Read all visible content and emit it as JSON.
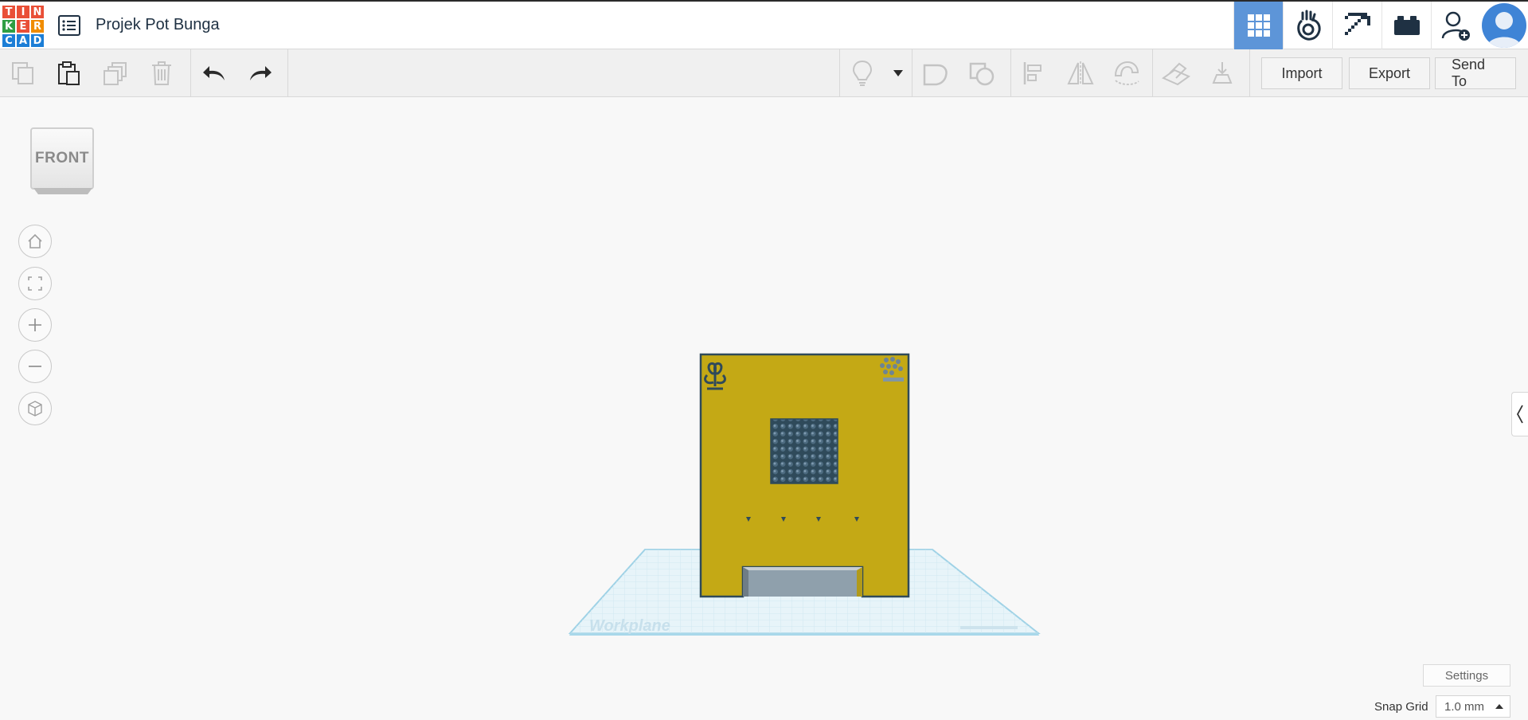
{
  "app": {
    "logo_letters": [
      "T",
      "I",
      "N",
      "K",
      "E",
      "R",
      "C",
      "A",
      "D"
    ],
    "logo_colors": [
      "#e94f37",
      "#e94f37",
      "#e94f37",
      "#2f9e44",
      "#e94f37",
      "#f08c00",
      "#1c7ed6",
      "#1c7ed6",
      "#1c7ed6"
    ],
    "project_title": "Projek Pot Bunga"
  },
  "top_nav": {
    "active_color": "#5d95d8",
    "icons": [
      "grid-3d-icon",
      "circuits-icon",
      "minecraft-pickaxe-icon",
      "lego-bricks-icon",
      "add-user-icon"
    ]
  },
  "toolbar": {
    "import_label": "Import",
    "export_label": "Export",
    "send_to_label": "Send To"
  },
  "viewcube": {
    "face_label": "FRONT"
  },
  "workplane": {
    "label": "Workplane",
    "label_color": "#c7e0ec"
  },
  "model": {
    "color": "#c4a915",
    "edge_color": "#2f4a5a"
  },
  "footer": {
    "settings_label": "Settings",
    "snap_grid_label": "Snap Grid",
    "snap_grid_value": "1.0 mm"
  }
}
